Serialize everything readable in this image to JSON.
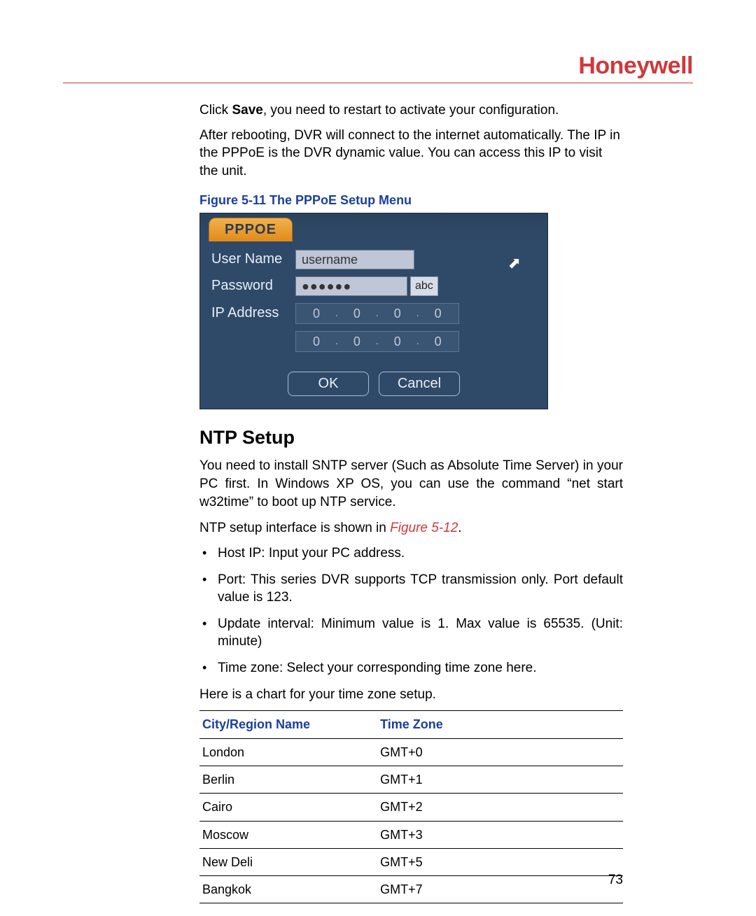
{
  "brand": "Honeywell",
  "intro": {
    "line1_pre": "Click ",
    "line1_strong": "Save",
    "line1_post": ", you need to restart to activate your configuration.",
    "line2": "After rebooting, DVR will connect to the internet automatically. The IP in the PPPoE is the DVR dynamic value. You can access this IP to visit the unit."
  },
  "figure_caption": "Figure 5-11 The PPPoE Setup Menu",
  "pppoe": {
    "tab": "PPPOE",
    "username_label": "User Name",
    "username_value": "username",
    "password_label": "Password",
    "password_value": "●●●●●●",
    "abc": "abc",
    "ip_label": "IP Address",
    "ip1": [
      "0",
      "0",
      "0",
      "0"
    ],
    "ip2": [
      "0",
      "0",
      "0",
      "0"
    ],
    "ok": "OK",
    "cancel": "Cancel"
  },
  "ntp": {
    "heading": "NTP Setup",
    "p1": "You need to install SNTP server (Such as Absolute Time Server) in your PC first. In Windows XP OS, you can use the command “net start w32time” to boot up NTP service.",
    "p2_pre": "NTP setup interface is shown in ",
    "p2_ref": "Figure 5-12",
    "p2_post": ".",
    "bullets": [
      "Host IP: Input your PC address.",
      "Port: This series DVR supports TCP transmission only. Port default value is 123.",
      "Update interval: Minimum value is 1. Max value is 65535. (Unit: minute)",
      "Time zone: Select your corresponding time zone here."
    ],
    "chart_intro": "Here is a chart for your time zone setup."
  },
  "table": {
    "headers": [
      "City/Region Name",
      "Time Zone"
    ],
    "rows": [
      [
        "London",
        "GMT+0"
      ],
      [
        "Berlin",
        "GMT+1"
      ],
      [
        "Cairo",
        "GMT+2"
      ],
      [
        "Moscow",
        "GMT+3"
      ],
      [
        "New Deli",
        "GMT+5"
      ],
      [
        "Bangkok",
        "GMT+7"
      ]
    ]
  },
  "page_number": "73"
}
